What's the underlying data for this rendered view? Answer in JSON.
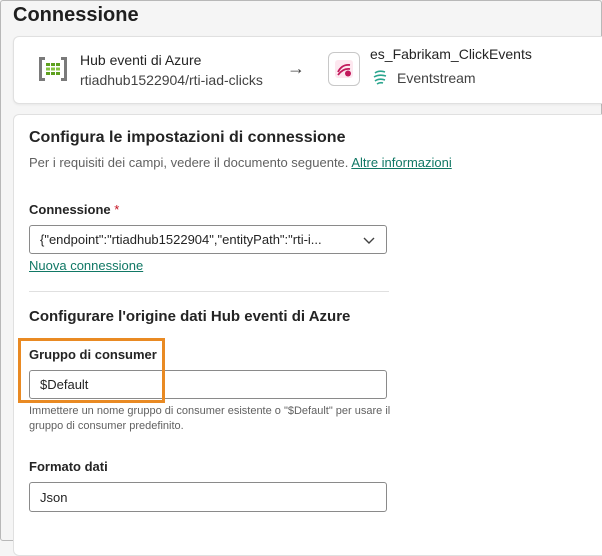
{
  "page": {
    "title": "Connessione"
  },
  "source": {
    "name": "Hub eventi di Azure",
    "path": "rtiadhub1522904/rti-iad-clicks",
    "icon": "event-hub-icon"
  },
  "destination": {
    "name": "es_Fabrikam_ClickEvents",
    "type": "Eventstream",
    "icon": "eventstream-icon"
  },
  "settings": {
    "heading": "Configura le impostazioni di connessione",
    "hint": "Per i requisiti dei campi, vedere il documento seguente.",
    "more_info": "Altre informazioni",
    "connection_label": "Connessione",
    "required_mark": "*",
    "connection_value": "{\"endpoint\":\"rtiadhub1522904\",\"entityPath\":\"rti-i...",
    "new_connection": "Nuova connessione"
  },
  "source_config": {
    "heading": "Configurare l'origine dati Hub eventi di Azure",
    "consumer_group_label": "Gruppo di consumer",
    "consumer_group_value": "$Default",
    "consumer_group_help": "Immettere un nome gruppo di consumer esistente o \"$Default\" per usare il gruppo di consumer predefinito.",
    "data_format_label": "Formato dati",
    "data_format_value": "Json"
  },
  "colors": {
    "accent": "#117865",
    "highlight": "#e98a23",
    "required": "#c50f1f"
  }
}
